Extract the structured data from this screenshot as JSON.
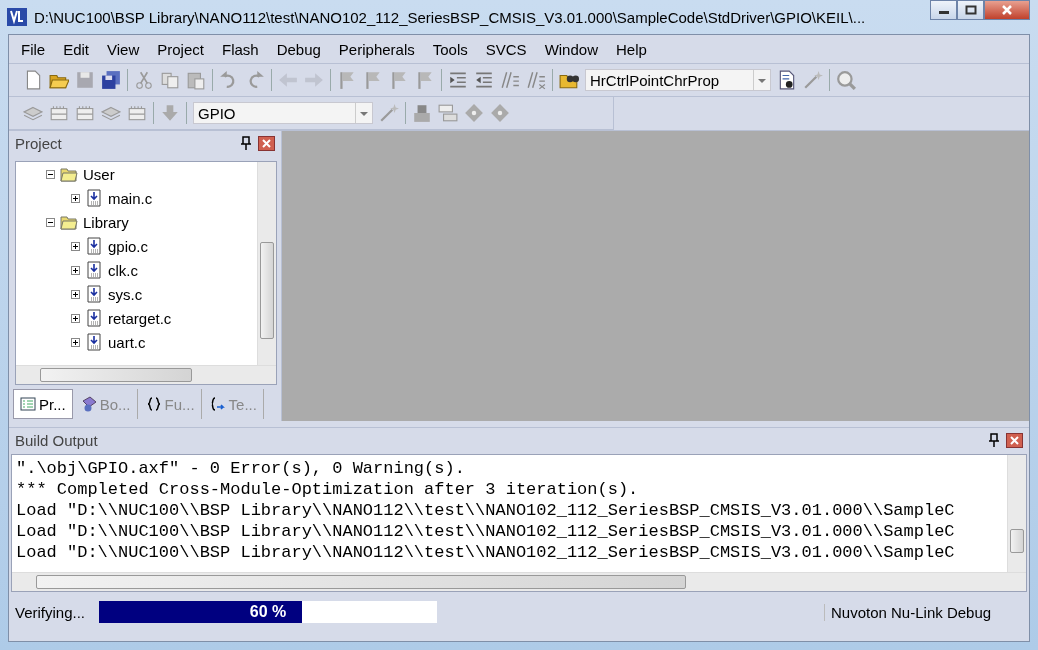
{
  "window": {
    "title": "D:\\NUC100\\BSP Library\\NANO112\\test\\NANO102_112_SeriesBSP_CMSIS_V3.01.000\\SampleCode\\StdDriver\\GPIO\\KEIL\\..."
  },
  "menu": [
    "File",
    "Edit",
    "View",
    "Project",
    "Flash",
    "Debug",
    "Peripherals",
    "Tools",
    "SVCS",
    "Window",
    "Help"
  ],
  "toolbar": {
    "find_combo": "HrCtrlPointChrProp",
    "target_combo": "GPIO"
  },
  "project_panel": {
    "title": "Project",
    "tree": [
      {
        "kind": "folder",
        "label": "User",
        "expanded": true,
        "children": [
          {
            "kind": "file",
            "label": "main.c",
            "expanded": false
          }
        ]
      },
      {
        "kind": "folder",
        "label": "Library",
        "expanded": true,
        "children": [
          {
            "kind": "file",
            "label": "gpio.c",
            "expanded": false
          },
          {
            "kind": "file",
            "label": "clk.c",
            "expanded": false
          },
          {
            "kind": "file",
            "label": "sys.c",
            "expanded": false
          },
          {
            "kind": "file",
            "label": "retarget.c",
            "expanded": false
          },
          {
            "kind": "file",
            "label": "uart.c",
            "expanded": false
          }
        ]
      }
    ],
    "tabs": [
      {
        "label": "Pr...",
        "selected": true
      },
      {
        "label": "Bo...",
        "selected": false
      },
      {
        "label": "Fu...",
        "selected": false
      },
      {
        "label": "Te...",
        "selected": false
      }
    ]
  },
  "build_output": {
    "title": "Build Output",
    "lines": [
      "\".\\obj\\GPIO.axf\" - 0 Error(s), 0 Warning(s).",
      "*** Completed Cross-Module-Optimization after 3 iteration(s).",
      "Load \"D:\\\\NUC100\\\\BSP Library\\\\NANO112\\\\test\\\\NANO102_112_SeriesBSP_CMSIS_V3.01.000\\\\SampleC",
      "Load \"D:\\\\NUC100\\\\BSP Library\\\\NANO112\\\\test\\\\NANO102_112_SeriesBSP_CMSIS_V3.01.000\\\\SampleC",
      "Load \"D:\\\\NUC100\\\\BSP Library\\\\NANO112\\\\test\\\\NANO102_112_SeriesBSP_CMSIS_V3.01.000\\\\SampleC"
    ]
  },
  "status_bar": {
    "text": "Verifying...",
    "progress": {
      "level": 0.6,
      "reading": "60 %"
    },
    "debugger": "Nuvoton Nu-Link Debug"
  }
}
